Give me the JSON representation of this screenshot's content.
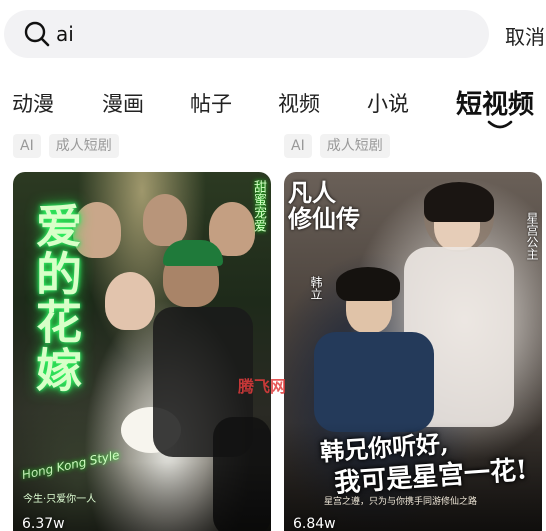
{
  "search": {
    "query": "ai",
    "cancel_label": "取消"
  },
  "tabs": [
    {
      "label": "动漫",
      "active": false
    },
    {
      "label": "漫画",
      "active": false
    },
    {
      "label": "帖子",
      "active": false
    },
    {
      "label": "视频",
      "active": false
    },
    {
      "label": "小说",
      "active": false
    },
    {
      "label": "短视频",
      "active": true
    }
  ],
  "cards": [
    {
      "tags": [
        "AI",
        "成人短剧"
      ],
      "cover_title": "爱的花嫁",
      "cover_subtitle": "今生·只爱你一人",
      "cover_script": "Hong Kong Style",
      "cover_badge": "甜蜜宠爱",
      "view_count": "6.37w"
    },
    {
      "tags": [
        "AI",
        "成人短剧"
      ],
      "cover_title": "凡人\n修仙传",
      "cover_name_left": "韩立",
      "cover_name_right": "星宫公主",
      "cover_headline_1": "韩兄你听好,",
      "cover_headline_2": "我可是星宫一花!",
      "cover_caption": "星宫之遵，只为与你携手同游修仙之路",
      "view_count": "6.84w"
    }
  ],
  "watermark": "腾飞网",
  "colors": {
    "search_bg": "#f2f2f4",
    "tag_bg": "#f2f2f2",
    "tag_text": "#999999",
    "neon_green": "#39ff6a",
    "watermark_red": "#e23c3c"
  }
}
